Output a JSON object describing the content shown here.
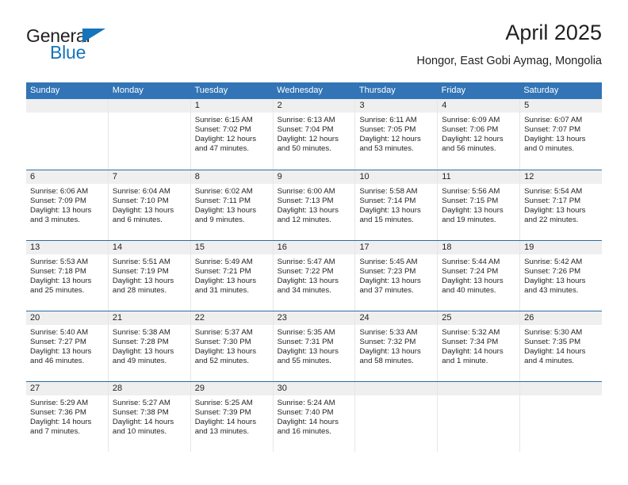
{
  "brand": {
    "word1": "General",
    "word2": "Blue",
    "triangle_color": "#1574bb"
  },
  "header": {
    "title": "April 2025",
    "subtitle": "Hongor, East Gobi Aymag, Mongolia"
  },
  "colors": {
    "header_blue": "#3274b5",
    "row_divider_blue": "#2e6da4",
    "day_band_gray": "#efefef",
    "text": "#231f20"
  },
  "calendar": {
    "weekday_headers": [
      "Sunday",
      "Monday",
      "Tuesday",
      "Wednesday",
      "Thursday",
      "Friday",
      "Saturday"
    ],
    "weeks": [
      [
        {
          "day": "",
          "empty": true
        },
        {
          "day": "",
          "empty": true
        },
        {
          "day": "1",
          "sunrise": "Sunrise: 6:15 AM",
          "sunset": "Sunset: 7:02 PM",
          "daylight1": "Daylight: 12 hours",
          "daylight2": "and 47 minutes."
        },
        {
          "day": "2",
          "sunrise": "Sunrise: 6:13 AM",
          "sunset": "Sunset: 7:04 PM",
          "daylight1": "Daylight: 12 hours",
          "daylight2": "and 50 minutes."
        },
        {
          "day": "3",
          "sunrise": "Sunrise: 6:11 AM",
          "sunset": "Sunset: 7:05 PM",
          "daylight1": "Daylight: 12 hours",
          "daylight2": "and 53 minutes."
        },
        {
          "day": "4",
          "sunrise": "Sunrise: 6:09 AM",
          "sunset": "Sunset: 7:06 PM",
          "daylight1": "Daylight: 12 hours",
          "daylight2": "and 56 minutes."
        },
        {
          "day": "5",
          "sunrise": "Sunrise: 6:07 AM",
          "sunset": "Sunset: 7:07 PM",
          "daylight1": "Daylight: 13 hours",
          "daylight2": "and 0 minutes."
        }
      ],
      [
        {
          "day": "6",
          "sunrise": "Sunrise: 6:06 AM",
          "sunset": "Sunset: 7:09 PM",
          "daylight1": "Daylight: 13 hours",
          "daylight2": "and 3 minutes."
        },
        {
          "day": "7",
          "sunrise": "Sunrise: 6:04 AM",
          "sunset": "Sunset: 7:10 PM",
          "daylight1": "Daylight: 13 hours",
          "daylight2": "and 6 minutes."
        },
        {
          "day": "8",
          "sunrise": "Sunrise: 6:02 AM",
          "sunset": "Sunset: 7:11 PM",
          "daylight1": "Daylight: 13 hours",
          "daylight2": "and 9 minutes."
        },
        {
          "day": "9",
          "sunrise": "Sunrise: 6:00 AM",
          "sunset": "Sunset: 7:13 PM",
          "daylight1": "Daylight: 13 hours",
          "daylight2": "and 12 minutes."
        },
        {
          "day": "10",
          "sunrise": "Sunrise: 5:58 AM",
          "sunset": "Sunset: 7:14 PM",
          "daylight1": "Daylight: 13 hours",
          "daylight2": "and 15 minutes."
        },
        {
          "day": "11",
          "sunrise": "Sunrise: 5:56 AM",
          "sunset": "Sunset: 7:15 PM",
          "daylight1": "Daylight: 13 hours",
          "daylight2": "and 19 minutes."
        },
        {
          "day": "12",
          "sunrise": "Sunrise: 5:54 AM",
          "sunset": "Sunset: 7:17 PM",
          "daylight1": "Daylight: 13 hours",
          "daylight2": "and 22 minutes."
        }
      ],
      [
        {
          "day": "13",
          "sunrise": "Sunrise: 5:53 AM",
          "sunset": "Sunset: 7:18 PM",
          "daylight1": "Daylight: 13 hours",
          "daylight2": "and 25 minutes."
        },
        {
          "day": "14",
          "sunrise": "Sunrise: 5:51 AM",
          "sunset": "Sunset: 7:19 PM",
          "daylight1": "Daylight: 13 hours",
          "daylight2": "and 28 minutes."
        },
        {
          "day": "15",
          "sunrise": "Sunrise: 5:49 AM",
          "sunset": "Sunset: 7:21 PM",
          "daylight1": "Daylight: 13 hours",
          "daylight2": "and 31 minutes."
        },
        {
          "day": "16",
          "sunrise": "Sunrise: 5:47 AM",
          "sunset": "Sunset: 7:22 PM",
          "daylight1": "Daylight: 13 hours",
          "daylight2": "and 34 minutes."
        },
        {
          "day": "17",
          "sunrise": "Sunrise: 5:45 AM",
          "sunset": "Sunset: 7:23 PM",
          "daylight1": "Daylight: 13 hours",
          "daylight2": "and 37 minutes."
        },
        {
          "day": "18",
          "sunrise": "Sunrise: 5:44 AM",
          "sunset": "Sunset: 7:24 PM",
          "daylight1": "Daylight: 13 hours",
          "daylight2": "and 40 minutes."
        },
        {
          "day": "19",
          "sunrise": "Sunrise: 5:42 AM",
          "sunset": "Sunset: 7:26 PM",
          "daylight1": "Daylight: 13 hours",
          "daylight2": "and 43 minutes."
        }
      ],
      [
        {
          "day": "20",
          "sunrise": "Sunrise: 5:40 AM",
          "sunset": "Sunset: 7:27 PM",
          "daylight1": "Daylight: 13 hours",
          "daylight2": "and 46 minutes."
        },
        {
          "day": "21",
          "sunrise": "Sunrise: 5:38 AM",
          "sunset": "Sunset: 7:28 PM",
          "daylight1": "Daylight: 13 hours",
          "daylight2": "and 49 minutes."
        },
        {
          "day": "22",
          "sunrise": "Sunrise: 5:37 AM",
          "sunset": "Sunset: 7:30 PM",
          "daylight1": "Daylight: 13 hours",
          "daylight2": "and 52 minutes."
        },
        {
          "day": "23",
          "sunrise": "Sunrise: 5:35 AM",
          "sunset": "Sunset: 7:31 PM",
          "daylight1": "Daylight: 13 hours",
          "daylight2": "and 55 minutes."
        },
        {
          "day": "24",
          "sunrise": "Sunrise: 5:33 AM",
          "sunset": "Sunset: 7:32 PM",
          "daylight1": "Daylight: 13 hours",
          "daylight2": "and 58 minutes."
        },
        {
          "day": "25",
          "sunrise": "Sunrise: 5:32 AM",
          "sunset": "Sunset: 7:34 PM",
          "daylight1": "Daylight: 14 hours",
          "daylight2": "and 1 minute."
        },
        {
          "day": "26",
          "sunrise": "Sunrise: 5:30 AM",
          "sunset": "Sunset: 7:35 PM",
          "daylight1": "Daylight: 14 hours",
          "daylight2": "and 4 minutes."
        }
      ],
      [
        {
          "day": "27",
          "sunrise": "Sunrise: 5:29 AM",
          "sunset": "Sunset: 7:36 PM",
          "daylight1": "Daylight: 14 hours",
          "daylight2": "and 7 minutes."
        },
        {
          "day": "28",
          "sunrise": "Sunrise: 5:27 AM",
          "sunset": "Sunset: 7:38 PM",
          "daylight1": "Daylight: 14 hours",
          "daylight2": "and 10 minutes."
        },
        {
          "day": "29",
          "sunrise": "Sunrise: 5:25 AM",
          "sunset": "Sunset: 7:39 PM",
          "daylight1": "Daylight: 14 hours",
          "daylight2": "and 13 minutes."
        },
        {
          "day": "30",
          "sunrise": "Sunrise: 5:24 AM",
          "sunset": "Sunset: 7:40 PM",
          "daylight1": "Daylight: 14 hours",
          "daylight2": "and 16 minutes."
        },
        {
          "day": "",
          "empty": true
        },
        {
          "day": "",
          "empty": true
        },
        {
          "day": "",
          "empty": true
        }
      ]
    ]
  }
}
